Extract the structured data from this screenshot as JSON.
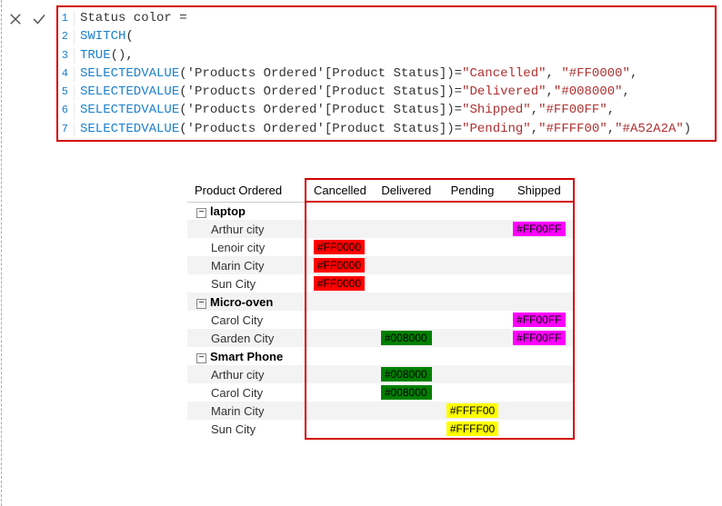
{
  "editor": {
    "lines": [
      {
        "num": "1",
        "tokens": [
          {
            "t": "Status color ",
            "c": "plain"
          },
          {
            "t": "=",
            "c": "plain"
          }
        ]
      },
      {
        "num": "2",
        "tokens": [
          {
            "t": "SWITCH",
            "c": "kw"
          },
          {
            "t": "(",
            "c": "punct"
          }
        ]
      },
      {
        "num": "3",
        "tokens": [
          {
            "t": "TRUE",
            "c": "kw"
          },
          {
            "t": "()",
            "c": "punct"
          },
          {
            "t": ",",
            "c": "punct"
          }
        ]
      },
      {
        "num": "4",
        "tokens": [
          {
            "t": "SELECTEDVALUE",
            "c": "kw"
          },
          {
            "t": "(",
            "c": "punct"
          },
          {
            "t": "'Products Ordered'[Product Status]",
            "c": "param"
          },
          {
            "t": ")=",
            "c": "punct"
          },
          {
            "t": "\"Cancelled\"",
            "c": "str"
          },
          {
            "t": ", ",
            "c": "punct"
          },
          {
            "t": "\"#FF0000\"",
            "c": "str"
          },
          {
            "t": ",",
            "c": "punct"
          }
        ]
      },
      {
        "num": "5",
        "tokens": [
          {
            "t": "SELECTEDVALUE",
            "c": "kw"
          },
          {
            "t": "(",
            "c": "punct"
          },
          {
            "t": "'Products Ordered'[Product Status]",
            "c": "param"
          },
          {
            "t": ")=",
            "c": "punct"
          },
          {
            "t": "\"Delivered\"",
            "c": "str"
          },
          {
            "t": ",",
            "c": "punct"
          },
          {
            "t": "\"#008000\"",
            "c": "str"
          },
          {
            "t": ",",
            "c": "punct"
          }
        ]
      },
      {
        "num": "6",
        "tokens": [
          {
            "t": "SELECTEDVALUE",
            "c": "kw"
          },
          {
            "t": "(",
            "c": "punct"
          },
          {
            "t": "'Products Ordered'[Product Status]",
            "c": "param"
          },
          {
            "t": ")=",
            "c": "punct"
          },
          {
            "t": "\"Shipped\"",
            "c": "str"
          },
          {
            "t": ",",
            "c": "punct"
          },
          {
            "t": "\"#FF00FF\"",
            "c": "str"
          },
          {
            "t": ",",
            "c": "punct"
          }
        ]
      },
      {
        "num": "7",
        "tokens": [
          {
            "t": "SELECTEDVALUE",
            "c": "kw"
          },
          {
            "t": "(",
            "c": "punct"
          },
          {
            "t": "'Products Ordered'[Product Status]",
            "c": "param"
          },
          {
            "t": ")=",
            "c": "punct"
          },
          {
            "t": "\"Pending\"",
            "c": "str"
          },
          {
            "t": ",",
            "c": "punct"
          },
          {
            "t": "\"#FFFF00\"",
            "c": "str"
          },
          {
            "t": ",",
            "c": "punct"
          },
          {
            "t": "\"#A52A2A\"",
            "c": "str"
          },
          {
            "t": ")",
            "c": "punct"
          }
        ]
      }
    ]
  },
  "matrix": {
    "row_header_label": "Product Ordered",
    "columns": [
      "Cancelled",
      "Delivered",
      "Pending",
      "Shipped"
    ],
    "column_colors": {
      "Cancelled": "#FF0000",
      "Delivered": "#008000",
      "Pending": "#FFFF00",
      "Shipped": "#FF00FF"
    },
    "column_text_colors": {
      "Cancelled": "#000",
      "Delivered": "#000",
      "Pending": "#000",
      "Shipped": "#000"
    },
    "groups": [
      {
        "name": "laptop",
        "rows": [
          {
            "label": "Arthur city",
            "cells": {
              "Shipped": "#FF00FF"
            }
          },
          {
            "label": "Lenoir city",
            "cells": {
              "Cancelled": "#FF0000"
            }
          },
          {
            "label": "Marin City",
            "cells": {
              "Cancelled": "#FF0000"
            }
          },
          {
            "label": "Sun City",
            "cells": {
              "Cancelled": "#FF0000"
            }
          }
        ]
      },
      {
        "name": "Micro-oven",
        "rows": [
          {
            "label": "Carol City",
            "cells": {
              "Shipped": "#FF00FF"
            }
          },
          {
            "label": "Garden City",
            "cells": {
              "Delivered": "#008000",
              "Shipped": "#FF00FF"
            }
          }
        ]
      },
      {
        "name": "Smart Phone",
        "rows": [
          {
            "label": "Arthur city",
            "cells": {
              "Delivered": "#008000"
            }
          },
          {
            "label": "Carol City",
            "cells": {
              "Delivered": "#008000"
            }
          },
          {
            "label": "Marin City",
            "cells": {
              "Pending": "#FFFF00"
            }
          },
          {
            "label": "Sun City",
            "cells": {
              "Pending": "#FFFF00"
            }
          }
        ]
      }
    ]
  },
  "expander_glyph": "−"
}
